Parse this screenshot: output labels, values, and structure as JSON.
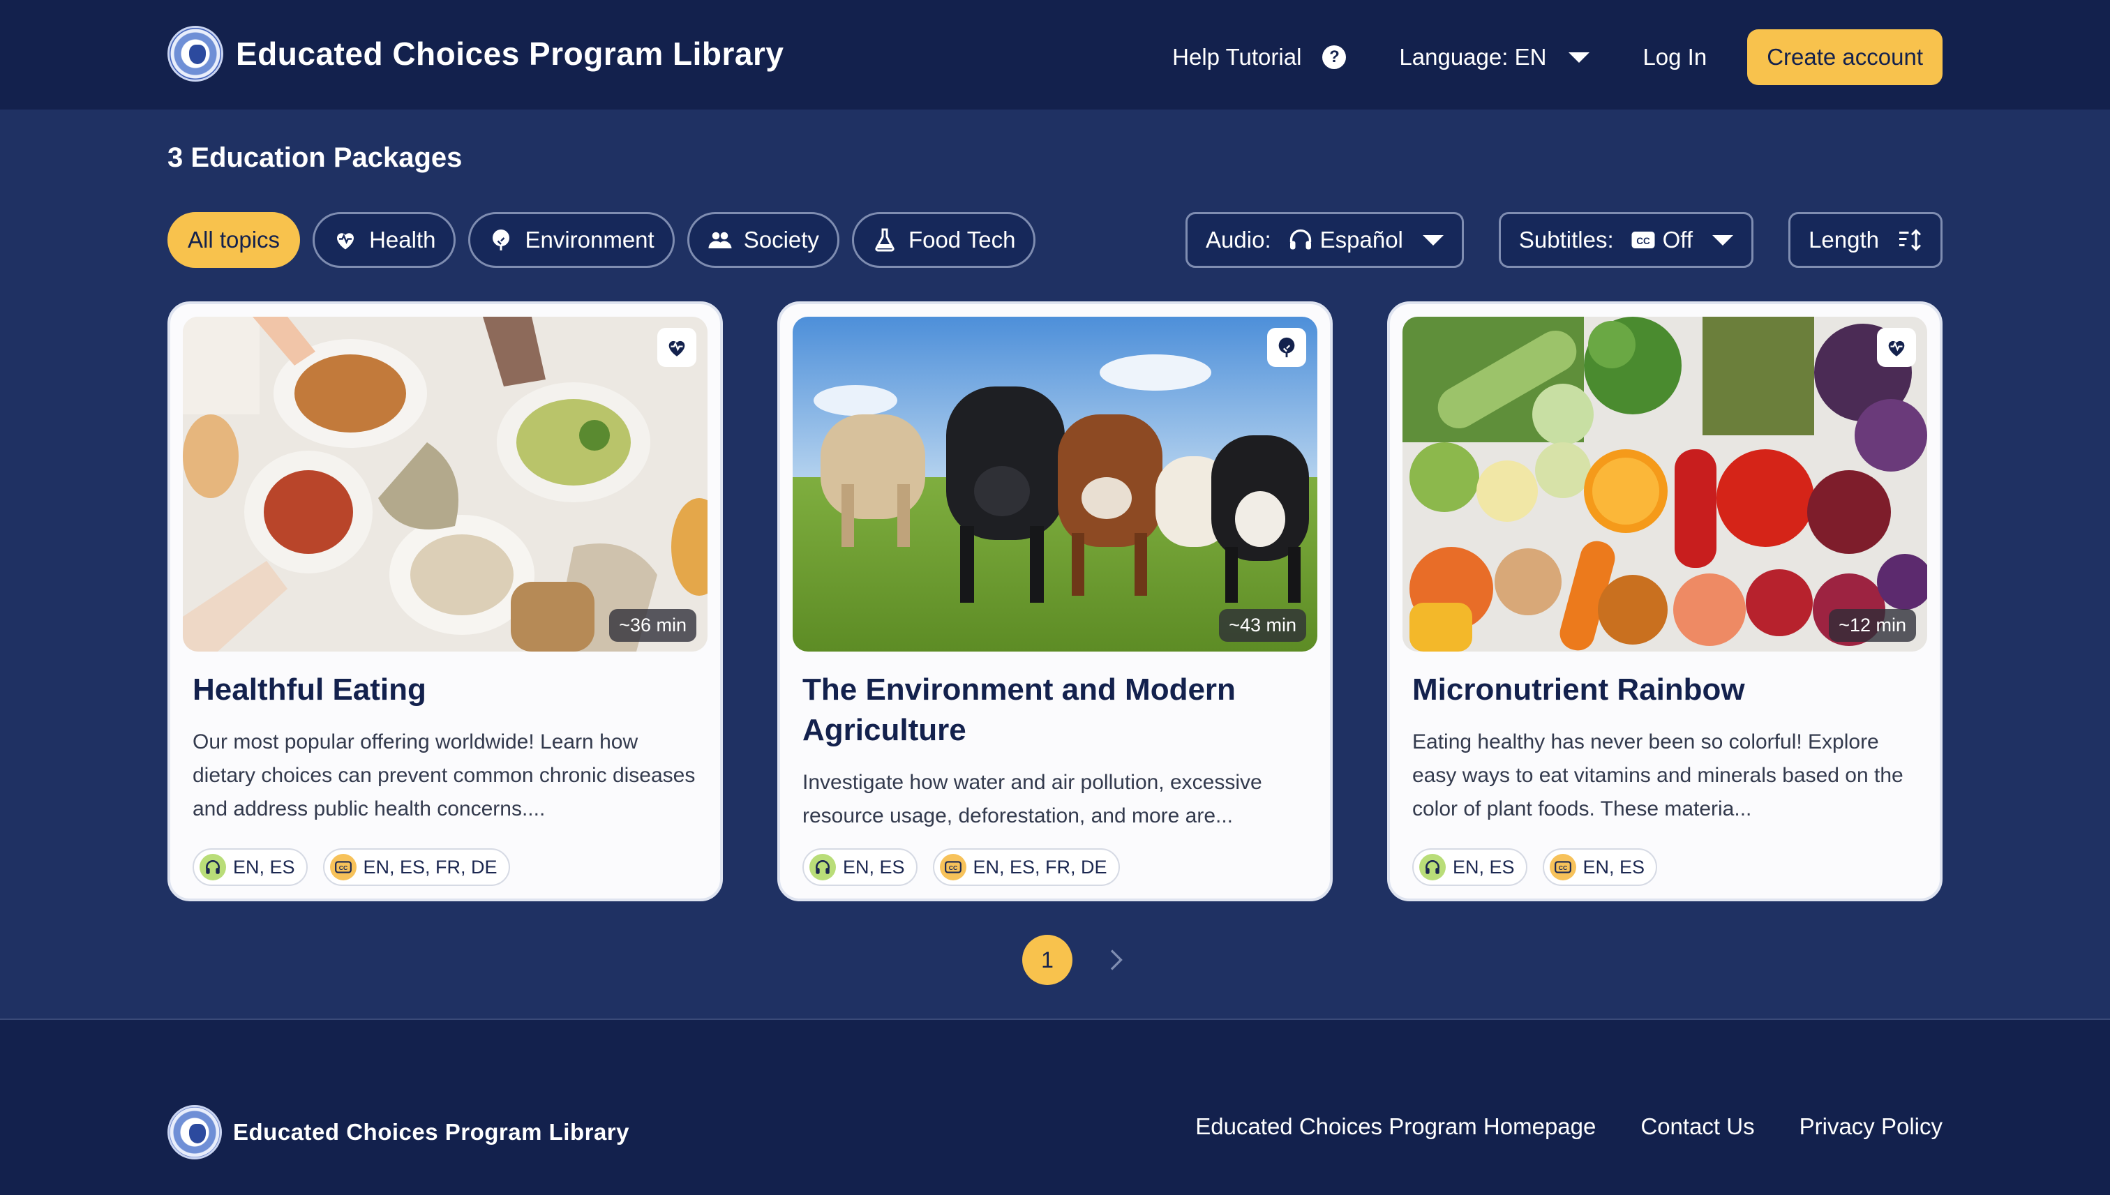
{
  "header": {
    "brand": "Educated Choices Program Library",
    "help": "Help Tutorial",
    "language": "Language: EN",
    "login": "Log In",
    "create": "Create account"
  },
  "count_label": "3 Education Packages",
  "filters": [
    {
      "label": "All topics",
      "icon": "",
      "active": true
    },
    {
      "label": "Health",
      "icon": "heart-icon",
      "active": false
    },
    {
      "label": "Environment",
      "icon": "tree-icon",
      "active": false
    },
    {
      "label": "Society",
      "icon": "people-icon",
      "active": false
    },
    {
      "label": "Food Tech",
      "icon": "flask-icon",
      "active": false
    }
  ],
  "selects": {
    "audio_label": "Audio:",
    "audio_value": "Español",
    "subtitles_label": "Subtitles:",
    "subtitles_value": "Off",
    "length_label": "Length"
  },
  "cards": [
    {
      "title": "Healthful Eating",
      "description": "Our most popular offering worldwide! Learn how dietary choices can prevent common chronic diseases and address public health concerns....",
      "duration": "~36 min",
      "topic_icon": "heart-pulse-icon",
      "audio": "EN, ES",
      "subtitles": "EN, ES, FR, DE"
    },
    {
      "title": "The Environment and Modern Agriculture",
      "description": "Investigate how water and air pollution, excessive resource usage, deforestation, and more are...",
      "duration": "~43 min",
      "topic_icon": "tree-icon",
      "audio": "EN, ES",
      "subtitles": "EN, ES, FR, DE"
    },
    {
      "title": "Micronutrient Rainbow",
      "description": "Eating healthy has never been so colorful! Explore easy ways to eat vitamins and minerals based on the color of plant foods. These materia...",
      "duration": "~12 min",
      "topic_icon": "heart-pulse-icon",
      "audio": "EN, ES",
      "subtitles": "EN, ES"
    }
  ],
  "pagination": {
    "current": "1"
  },
  "footer": {
    "brand": "Educated Choices Program Library",
    "links": [
      "Educated Choices Program Homepage",
      "Contact Us",
      "Privacy Policy"
    ]
  },
  "colors": {
    "page_bg": "#1f3163",
    "header_bg": "#13214d",
    "accent": "#f8c24d",
    "card_bg": "#fbfbfd"
  }
}
